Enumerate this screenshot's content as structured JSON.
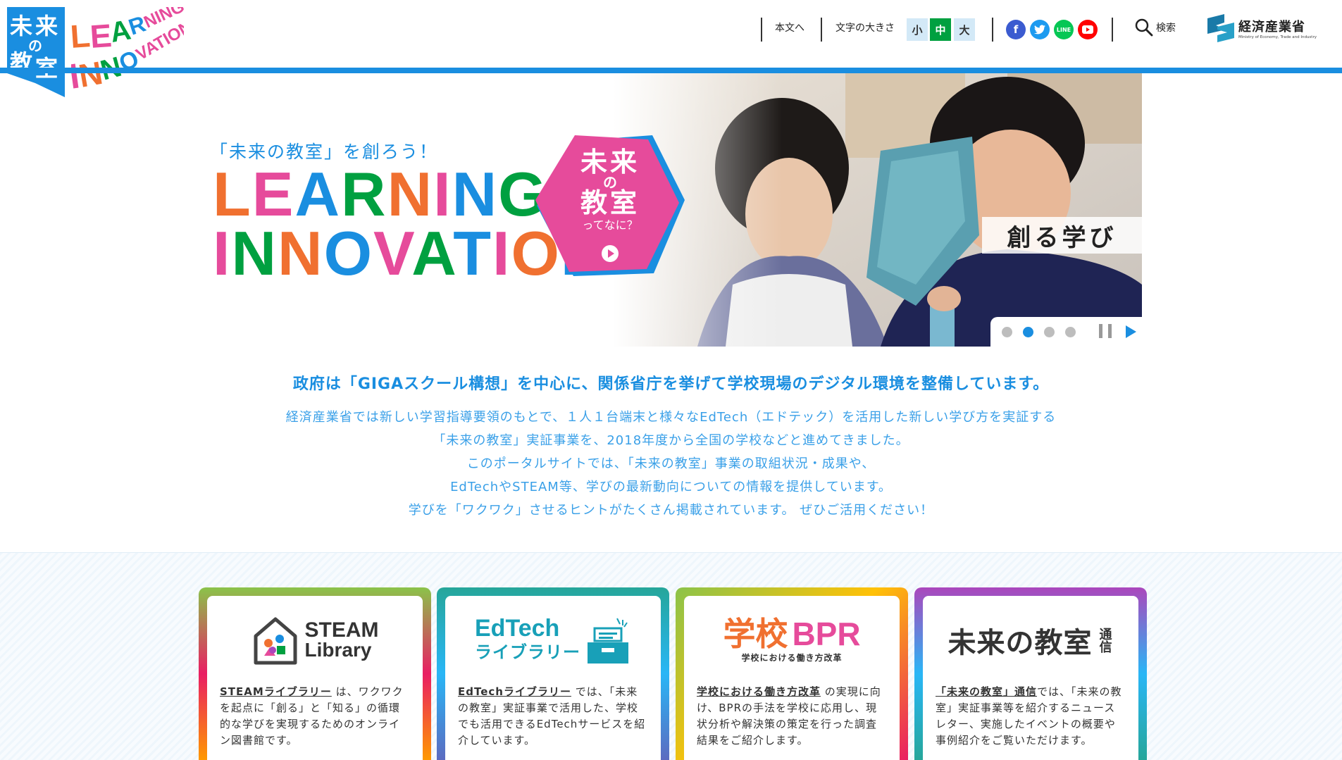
{
  "header": {
    "logo_badge_text": "未来の教室",
    "logo_text_line1": "LEARNING",
    "logo_text_line2": "INNOVATION",
    "skip_link": "本文へ",
    "font_size_label": "文字の大きさ",
    "font_sizes": [
      "小",
      "中",
      "大"
    ],
    "font_size_selected": "中",
    "social_icons": [
      "facebook-icon",
      "twitter-icon",
      "line-icon",
      "youtube-icon"
    ],
    "line_icon_text": "LINE",
    "search_label": "検索",
    "ministry_name": "経済産業省",
    "ministry_name_en": "Ministry of Economy, Trade and Industry"
  },
  "hero": {
    "tagline": "「未来の教室」を創ろう！",
    "title_line1": "LEARNING",
    "title_line2": "INNOVATION",
    "hexagon_title_1": "未来",
    "hexagon_title_2": "の",
    "hexagon_title_3": "教室",
    "hexagon_sub": "ってなに？",
    "slide_label": "創る学び",
    "slide_count": 4,
    "active_slide": 2
  },
  "intro": {
    "heading": "政府は「GIGAスクール構想」を中心に、関係省庁を挙げて学校現場のデジタル環境を整備しています。",
    "lines": [
      "経済産業省では新しい学習指導要領のもとで、１人１台端末と様々なEdTech（エドテック）を活用した新しい学び方を実証する",
      "「未来の教室」実証事業を、2018年度から全国の学校などと進めてきました。",
      "このポータルサイトでは、「未来の教室」事業の取組状況・成果や、",
      "EdTechやSTEAM等、学びの最新動向についての情報を提供しています。",
      "学びを「ワクワク」させるヒントがたくさん掲載されています。 ぜひご活用ください！"
    ]
  },
  "cards": [
    {
      "logo_line1": "STEAM",
      "logo_line2": "Library",
      "link": "STEAMライブラリー",
      "desc": " は、ワクワクを起点に「創る」と「知る」の循環的な学びを実現するためのオンライン図書館です。"
    },
    {
      "logo_line1": "EdTech",
      "logo_line2": "ライブラリー",
      "link": "EdTechライブラリー",
      "desc": " では、「未来の教室」実証事業で活用した、学校でも活用できるEdTechサービスを紹介しています。"
    },
    {
      "logo_line1": "学校",
      "logo_line1b": "BPR",
      "logo_line2": "学校における働き方改革",
      "link": "学校における働き方改革",
      "desc": " の実現に向け、BPRの手法を学校に応用し、現状分析や解決策の策定を行った調査結果をご紹介します。"
    },
    {
      "logo_line1": "未来の教室",
      "logo_line1b": "通信",
      "link": "「未来の教室」通信",
      "desc": "では、「未来の教室」実証事業等を紹介するニュースレター、実施したイベントの概要や事例紹介をご覧いただけます。"
    }
  ],
  "colors": {
    "brand_blue": "#1a8ee0",
    "green": "#00a040",
    "pink": "#e64b9b",
    "orange": "#f07030"
  }
}
